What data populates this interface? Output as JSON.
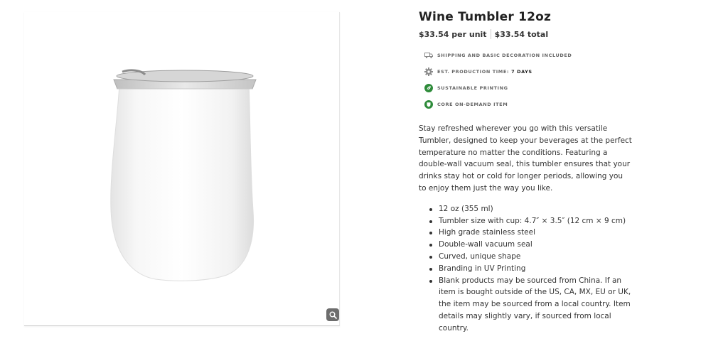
{
  "product": {
    "title": "Wine Tumbler 12oz",
    "price_per_unit": "$33.54 per unit",
    "price_total": "$33.54 total",
    "image_alt_icon": "tumbler-product-image"
  },
  "features": [
    {
      "icon": "truck-icon",
      "label": "SHIPPING AND BASIC DECORATION INCLUDED",
      "value": ""
    },
    {
      "icon": "gear-icon",
      "label": "EST. PRODUCTION TIME:",
      "value": "7 DAYS"
    },
    {
      "icon": "leaf-icon",
      "label": "SUSTAINABLE PRINTING",
      "value": ""
    },
    {
      "icon": "shield-icon",
      "label": "CORE ON-DEMAND ITEM",
      "value": ""
    }
  ],
  "description": "Stay refreshed wherever you go with this versatile Tumbler, designed to keep your beverages at the perfect temperature no matter the conditions. Featuring a double-wall vacuum seal, this tumbler ensures that your drinks stay hot or cold for longer periods, allowing you to enjoy them just the way you like.",
  "bullets": [
    "12 oz (355 ml)",
    "Tumbler size with cup: 4.7″ × 3.5″ (12 cm × 9 cm)",
    "High grade stainless steel",
    "Double-wall vacuum seal",
    "Curved, unique shape",
    "Branding in UV Printing",
    "Blank products may be sourced from China. If an item is bought outside of the US, CA, MX, EU or UK, the item may be sourced from a local country. Item details may slightly vary, if sourced from local country."
  ],
  "colors": {
    "accent_green": "#2e8b3a",
    "icon_gray": "#8a8a8a",
    "zoom_button": "#6d6d6d"
  }
}
